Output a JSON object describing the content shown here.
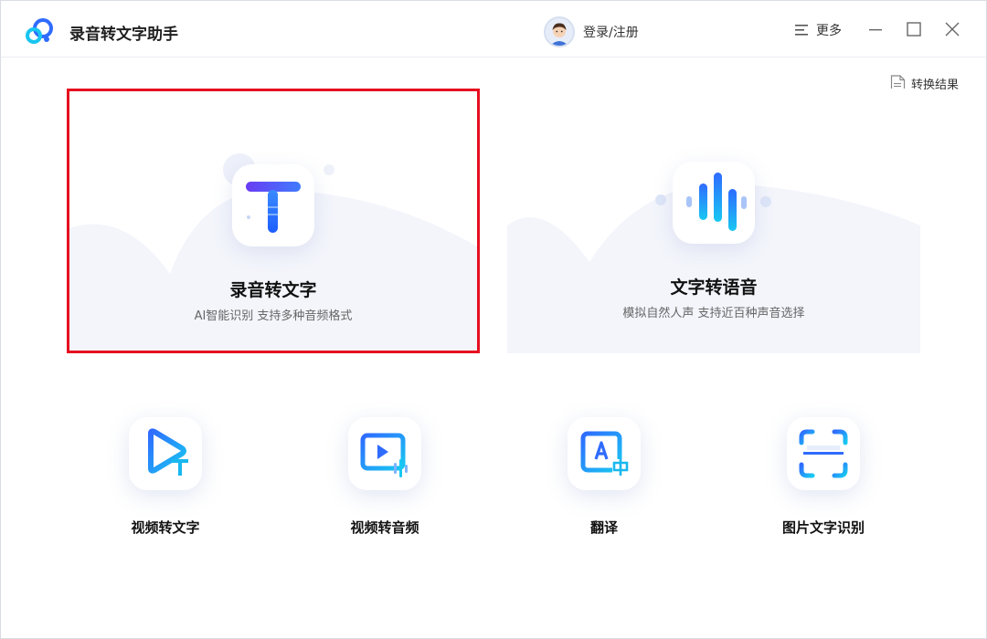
{
  "app": {
    "title": "录音转文字助手"
  },
  "header": {
    "login_label": "登录/注册",
    "more_label": "更多"
  },
  "result_link": {
    "label": "转换结果"
  },
  "cards": [
    {
      "title": "录音转文字",
      "subtitle": "AI智能识别 支持多种音频格式",
      "icon": "text-t-icon",
      "selected": true
    },
    {
      "title": "文字转语音",
      "subtitle": "模拟自然人声 支持近百种声音选择",
      "icon": "sound-wave-icon",
      "selected": false
    }
  ],
  "tools": [
    {
      "label": "视频转文字",
      "icon": "video-to-text-icon"
    },
    {
      "label": "视频转音频",
      "icon": "video-to-audio-icon"
    },
    {
      "label": "翻译",
      "icon": "translate-icon"
    },
    {
      "label": "图片文字识别",
      "icon": "scan-ocr-icon"
    }
  ],
  "colors": {
    "accent_blue": "#2f6bff",
    "cyan": "#18c5f0",
    "selection_red": "#e60f20"
  }
}
